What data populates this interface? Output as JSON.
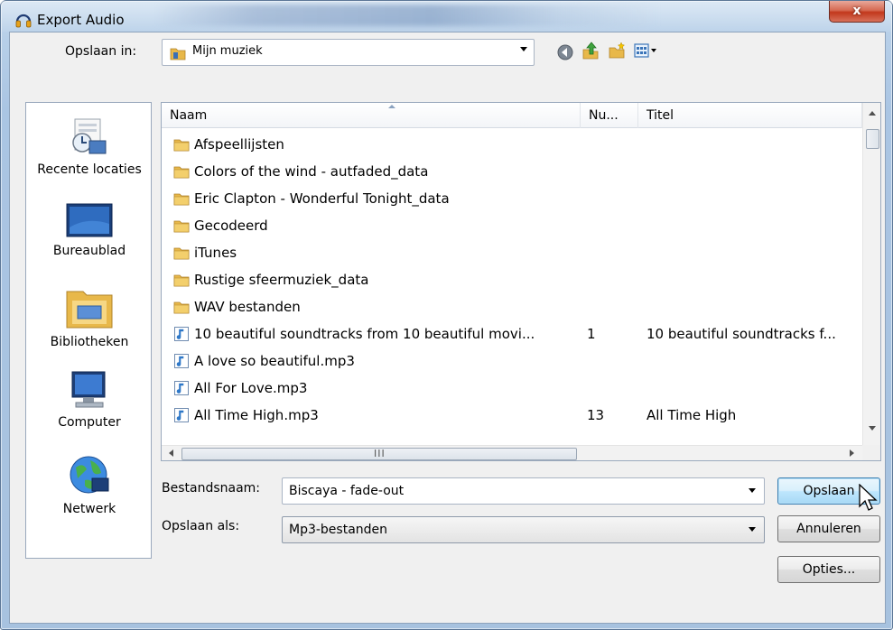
{
  "window": {
    "title": "Export Audio",
    "close_label": "x"
  },
  "location": {
    "label": "Opslaan in:",
    "value": "Mijn muziek"
  },
  "toolbar": {
    "icons": [
      "back-icon",
      "up-folder-icon",
      "new-folder-icon",
      "view-menu-icon"
    ]
  },
  "places": [
    {
      "label": "Recente locaties",
      "icon": "recent-places-icon"
    },
    {
      "label": "Bureaublad",
      "icon": "desktop-icon"
    },
    {
      "label": "Bibliotheken",
      "icon": "libraries-icon"
    },
    {
      "label": "Computer",
      "icon": "computer-icon"
    },
    {
      "label": "Netwerk",
      "icon": "network-icon"
    }
  ],
  "columns": {
    "name": "Naam",
    "number": "Nu...",
    "title": "Titel"
  },
  "files": [
    {
      "type": "folder",
      "name": "Afspeellijsten",
      "number": "",
      "title": ""
    },
    {
      "type": "folder",
      "name": "Colors of the wind - autfaded_data",
      "number": "",
      "title": ""
    },
    {
      "type": "folder",
      "name": "Eric Clapton - Wonderful Tonight_data",
      "number": "",
      "title": ""
    },
    {
      "type": "folder",
      "name": "Gecodeerd",
      "number": "",
      "title": ""
    },
    {
      "type": "folder",
      "name": "iTunes",
      "number": "",
      "title": ""
    },
    {
      "type": "folder",
      "name": "Rustige sfeermuziek_data",
      "number": "",
      "title": ""
    },
    {
      "type": "folder",
      "name": "WAV bestanden",
      "number": "",
      "title": ""
    },
    {
      "type": "audio",
      "name": "10 beautiful soundtracks from 10 beautiful movi...",
      "number": "1",
      "title": "10 beautiful soundtracks f..."
    },
    {
      "type": "audio",
      "name": "A love so beautiful.mp3",
      "number": "",
      "title": ""
    },
    {
      "type": "audio",
      "name": "All For Love.mp3",
      "number": "",
      "title": ""
    },
    {
      "type": "audio",
      "name": "All Time High.mp3",
      "number": "13",
      "title": "All Time High"
    }
  ],
  "hscroll_grip": "III",
  "filename": {
    "label": "Bestandsnaam:",
    "value": "Biscaya - fade-out"
  },
  "filetype": {
    "label": "Opslaan als:",
    "value": "Mp3-bestanden"
  },
  "buttons": {
    "save": "Opslaan",
    "cancel": "Annuleren",
    "options": "Opties..."
  },
  "colors": {
    "folder": "#e8b84a",
    "audio_icon": "#2f78c8",
    "close_button": "#c2381c"
  }
}
